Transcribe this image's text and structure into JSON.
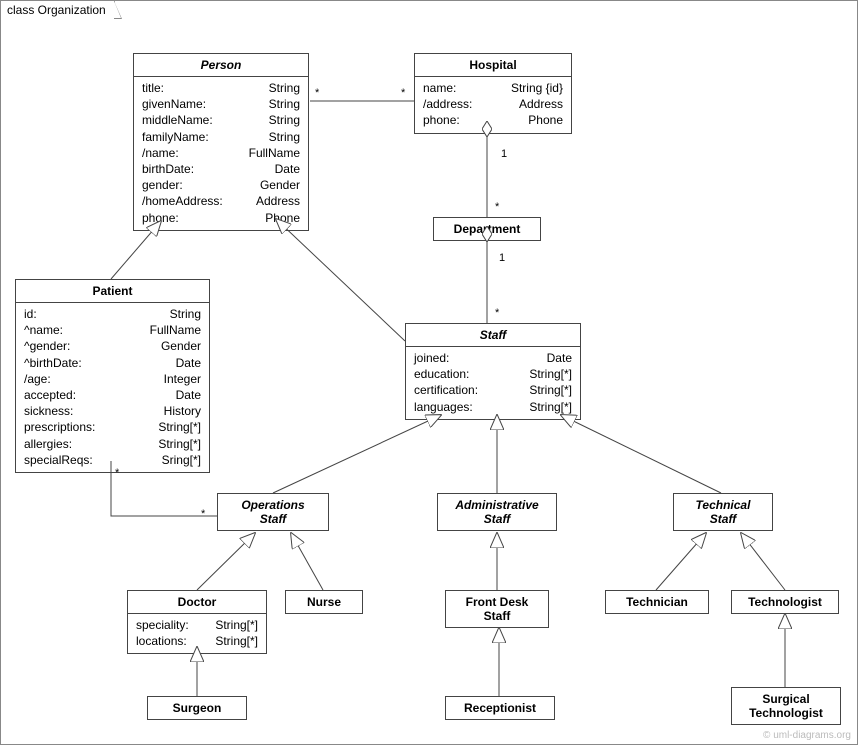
{
  "frame": {
    "label": "class Organization"
  },
  "watermark": "© uml-diagrams.org",
  "classes": {
    "person": {
      "title": "Person",
      "attrs": [
        {
          "n": "title:",
          "t": "String"
        },
        {
          "n": "givenName:",
          "t": "String"
        },
        {
          "n": "middleName:",
          "t": "String"
        },
        {
          "n": "familyName:",
          "t": "String"
        },
        {
          "n": "/name:",
          "t": "FullName"
        },
        {
          "n": "birthDate:",
          "t": "Date"
        },
        {
          "n": "gender:",
          "t": "Gender"
        },
        {
          "n": "/homeAddress:",
          "t": "Address"
        },
        {
          "n": "phone:",
          "t": "Phone"
        }
      ]
    },
    "hospital": {
      "title": "Hospital",
      "attrs": [
        {
          "n": "name:",
          "t": "String {id}"
        },
        {
          "n": "/address:",
          "t": "Address"
        },
        {
          "n": "phone:",
          "t": "Phone"
        }
      ]
    },
    "department": {
      "title": "Department"
    },
    "patient": {
      "title": "Patient",
      "attrs": [
        {
          "n": "id:",
          "t": "String"
        },
        {
          "n": "^name:",
          "t": "FullName"
        },
        {
          "n": "^gender:",
          "t": "Gender"
        },
        {
          "n": "^birthDate:",
          "t": "Date"
        },
        {
          "n": "/age:",
          "t": "Integer"
        },
        {
          "n": "accepted:",
          "t": "Date"
        },
        {
          "n": "sickness:",
          "t": "History"
        },
        {
          "n": "prescriptions:",
          "t": "String[*]"
        },
        {
          "n": "allergies:",
          "t": "String[*]"
        },
        {
          "n": "specialReqs:",
          "t": "Sring[*]"
        }
      ]
    },
    "staff": {
      "title": "Staff",
      "attrs": [
        {
          "n": "joined:",
          "t": "Date"
        },
        {
          "n": "education:",
          "t": "String[*]"
        },
        {
          "n": "certification:",
          "t": "String[*]"
        },
        {
          "n": "languages:",
          "t": "String[*]"
        }
      ]
    },
    "opsStaff": {
      "title": "Operations\nStaff"
    },
    "adminStaff": {
      "title": "Administrative\nStaff"
    },
    "techStaff": {
      "title": "Technical\nStaff"
    },
    "doctor": {
      "title": "Doctor",
      "attrs": [
        {
          "n": "speciality:",
          "t": "String[*]"
        },
        {
          "n": "locations:",
          "t": "String[*]"
        }
      ]
    },
    "nurse": {
      "title": "Nurse"
    },
    "frontdesk": {
      "title": "Front Desk\nStaff"
    },
    "technician": {
      "title": "Technician"
    },
    "technologist": {
      "title": "Technologist"
    },
    "surgeon": {
      "title": "Surgeon"
    },
    "receptionist": {
      "title": "Receptionist"
    },
    "surgtech": {
      "title": "Surgical\nTechnologist"
    }
  },
  "mults": {
    "personHospL": "*",
    "personHospR": "*",
    "hospDept1": "1",
    "hospDeptS": "*",
    "deptStaff1": "1",
    "deptStaffS": "*",
    "patOpsL": "*",
    "patOpsR": "*"
  }
}
